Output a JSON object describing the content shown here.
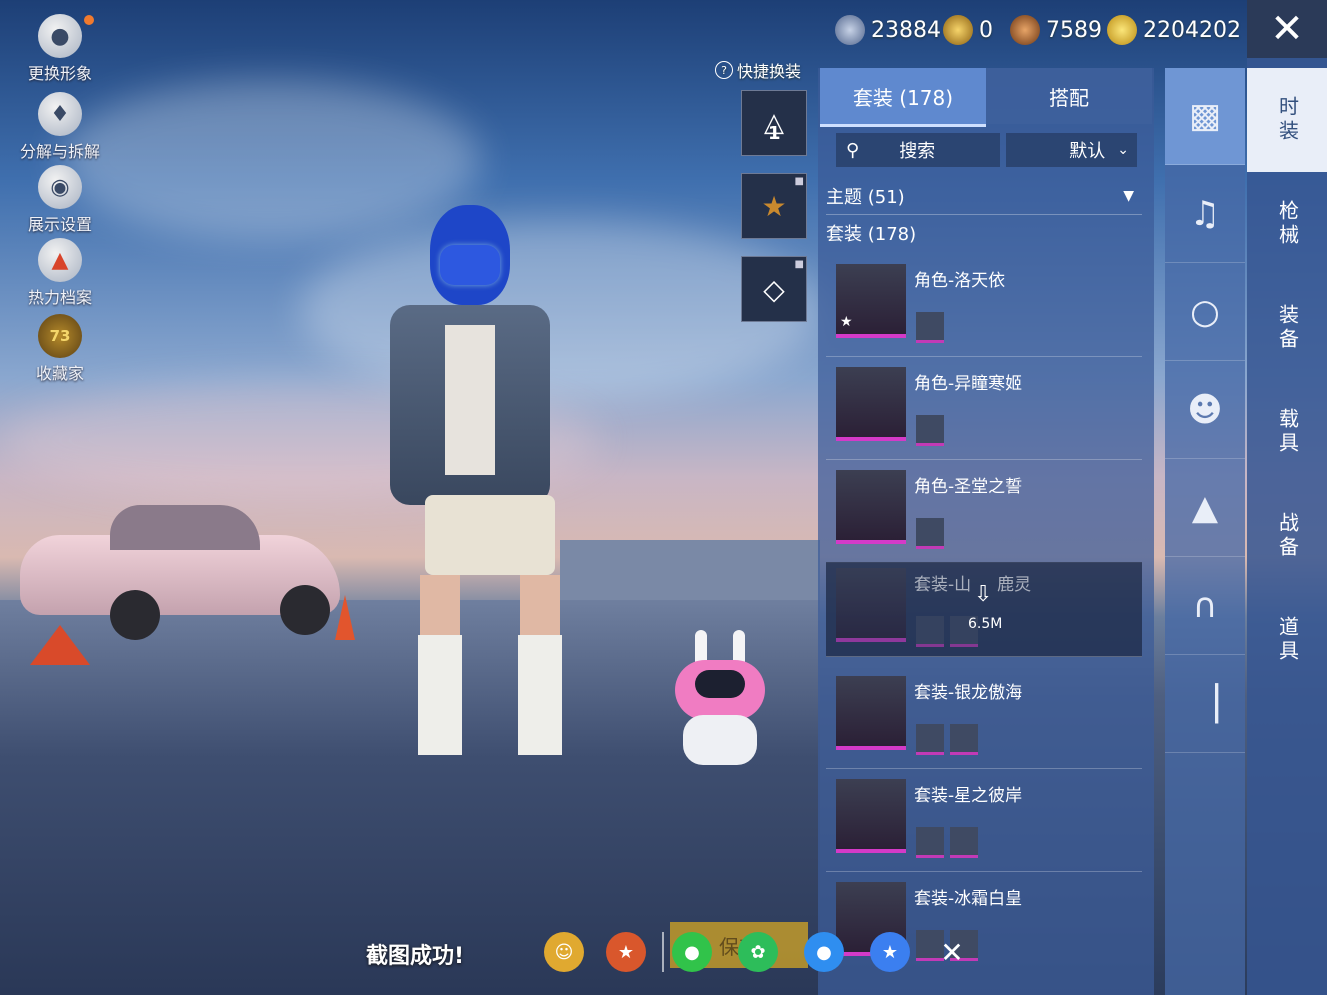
{
  "left_menu": [
    {
      "label": "更换形象",
      "icon": "avatar-icon"
    },
    {
      "label": "分解与拆解",
      "icon": "puzzle-icon"
    },
    {
      "label": "展示设置",
      "icon": "eye-icon"
    },
    {
      "label": "热力档案",
      "icon": "flame-icon"
    },
    {
      "label": "收藏家",
      "icon": "collector-badge-icon",
      "badge": "73"
    }
  ],
  "currencies": [
    {
      "value": "23884",
      "icon": "silver-coin-icon",
      "color": "#7f93b6"
    },
    {
      "value": "0",
      "icon": "gold-token-icon",
      "color": "#d9a31f"
    },
    {
      "value": "7589",
      "icon": "bronze-coin-icon",
      "color": "#b86a2e"
    },
    {
      "value": "2204202",
      "icon": "lightning-coin-icon",
      "color": "#e7c43a"
    }
  ],
  "quick_outfit_label": "快捷换装",
  "side_buttons": [
    {
      "icon": "hanger-slot-icon",
      "label": "1",
      "locked": false
    },
    {
      "icon": "trophy-shield-icon",
      "label": "",
      "locked": true
    },
    {
      "icon": "diamond-icon",
      "label": "",
      "locked": true
    }
  ],
  "tabs": [
    {
      "label": "套装 (178)",
      "active": true
    },
    {
      "label": "搭配",
      "active": false
    }
  ],
  "search": {
    "label": "搜索",
    "sort": "默认"
  },
  "theme_filter": "主题 (51)",
  "list_header": "套装 (178)",
  "items": [
    {
      "name": "角色-洛天依",
      "minis": 1
    },
    {
      "name": "角色-异瞳寒姬",
      "minis": 1
    },
    {
      "name": "角色-圣堂之誓",
      "minis": 1
    },
    {
      "name": "套装-山",
      "name_tail": "鹿灵",
      "minis": 2,
      "download": "6.5M",
      "highlighted": true
    },
    {
      "name": "套装-银龙傲海",
      "minis": 2
    },
    {
      "name": "套装-星之彼岸",
      "minis": 2
    },
    {
      "name": "套装-冰霜白皇",
      "minis": 2
    }
  ],
  "categories": [
    "时装",
    "枪械",
    "装备",
    "载具",
    "战备",
    "道具"
  ],
  "rail_icons": [
    "outfit-box-icon",
    "trumpet-icon",
    "goggles-icon",
    "mask-icon",
    "jacket-icon",
    "pants-icon",
    "shoes-icon"
  ],
  "screenshot_msg": "截图成功!",
  "save_label": "保存",
  "colors": {
    "accent_pink": "#d43ac8",
    "panel": "#3c5c98",
    "active_tab": "#5f89cf"
  }
}
